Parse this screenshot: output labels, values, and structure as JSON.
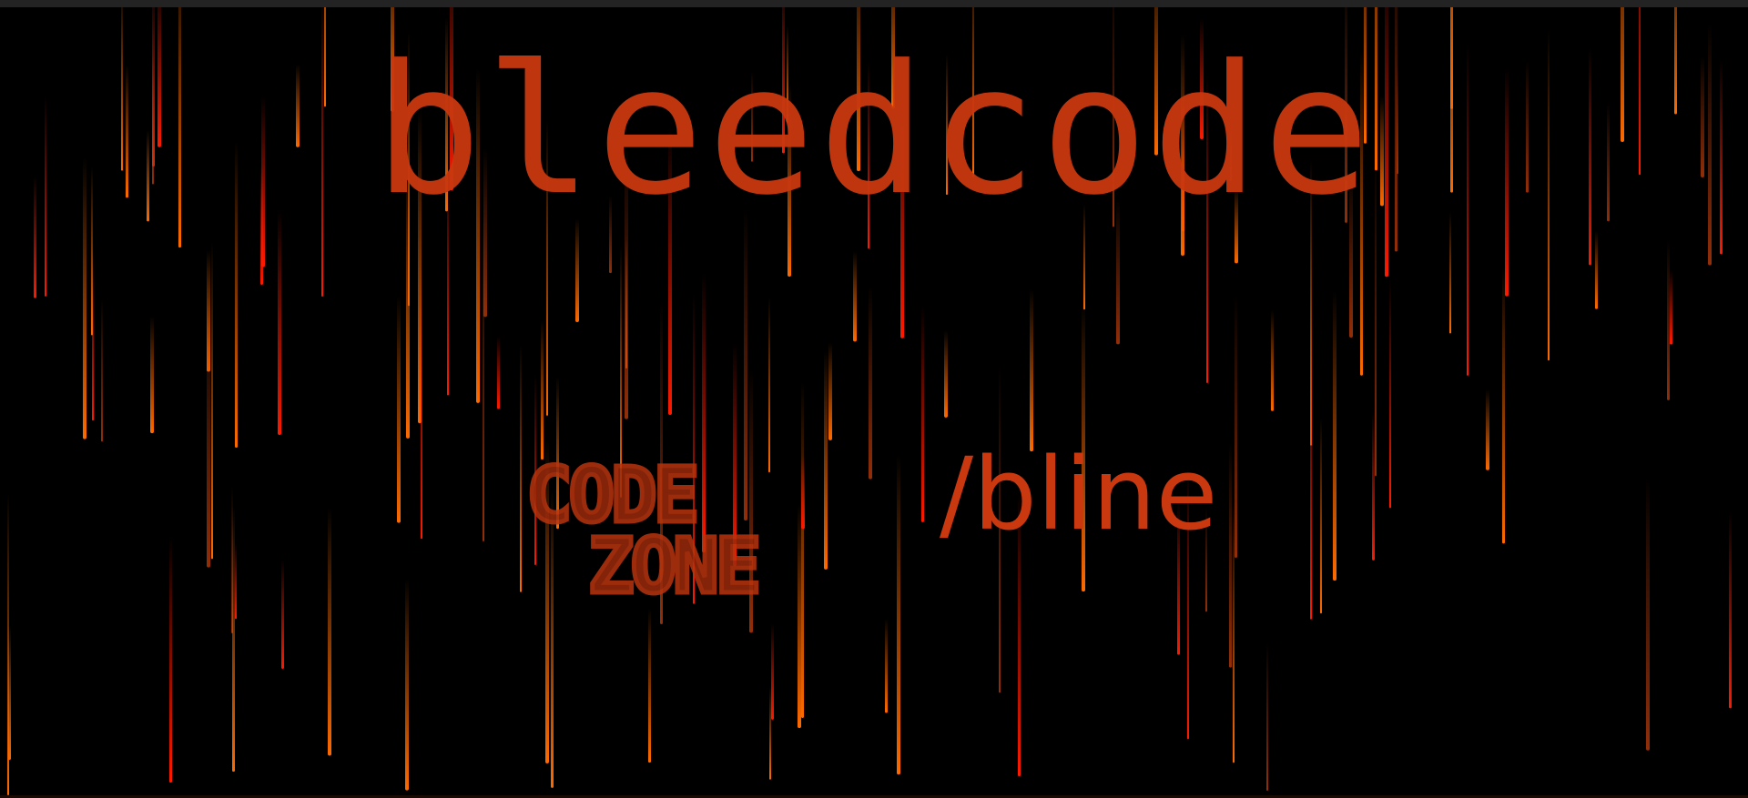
{
  "title": "bleedcode",
  "logo": {
    "line1": "CODE",
    "line2": "ZONE"
  },
  "slogan": "/bline",
  "colors": {
    "background": "#000000",
    "accent": "#c9380f",
    "rain_red": "#ff1a00",
    "rain_orange": "#ff6a00"
  }
}
